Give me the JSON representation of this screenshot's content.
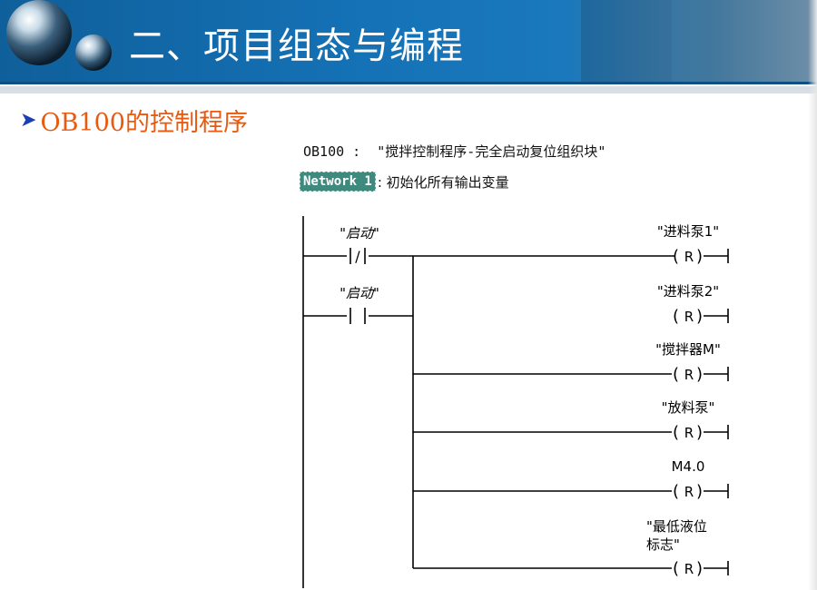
{
  "slide": {
    "title": "二、项目组态与编程",
    "bullet": "OB100的控制程序"
  },
  "program": {
    "block_header": "OB100 :  \"搅拌控制程序-完全启动复位组织块\"",
    "network_label": "Network 1",
    "network_comment": ": 初始化所有输出变量",
    "contacts": [
      {
        "label": "\"启动\"",
        "type": "normally-closed",
        "symbol": "/"
      },
      {
        "label": "\"启动\"",
        "type": "normally-open",
        "symbol": ""
      }
    ],
    "coils": [
      {
        "label": "\"进料泵1\"",
        "label2": "",
        "symbol": "R"
      },
      {
        "label": "\"进料泵2\"",
        "label2": "",
        "symbol": "R"
      },
      {
        "label": "\"搅拌器M\"",
        "label2": "",
        "symbol": "R"
      },
      {
        "label": "\"放料泵\"",
        "label2": "",
        "symbol": "R"
      },
      {
        "label": "M4.0",
        "label2": "",
        "symbol": "R"
      },
      {
        "label": "\"最低液位",
        "label2": "标志\"",
        "symbol": "R"
      }
    ]
  },
  "colors": {
    "banner": "#1572b6",
    "subtitle": "#e85a10",
    "bullet": "#1b3fb3",
    "network_tag": "#3f8a7f"
  }
}
